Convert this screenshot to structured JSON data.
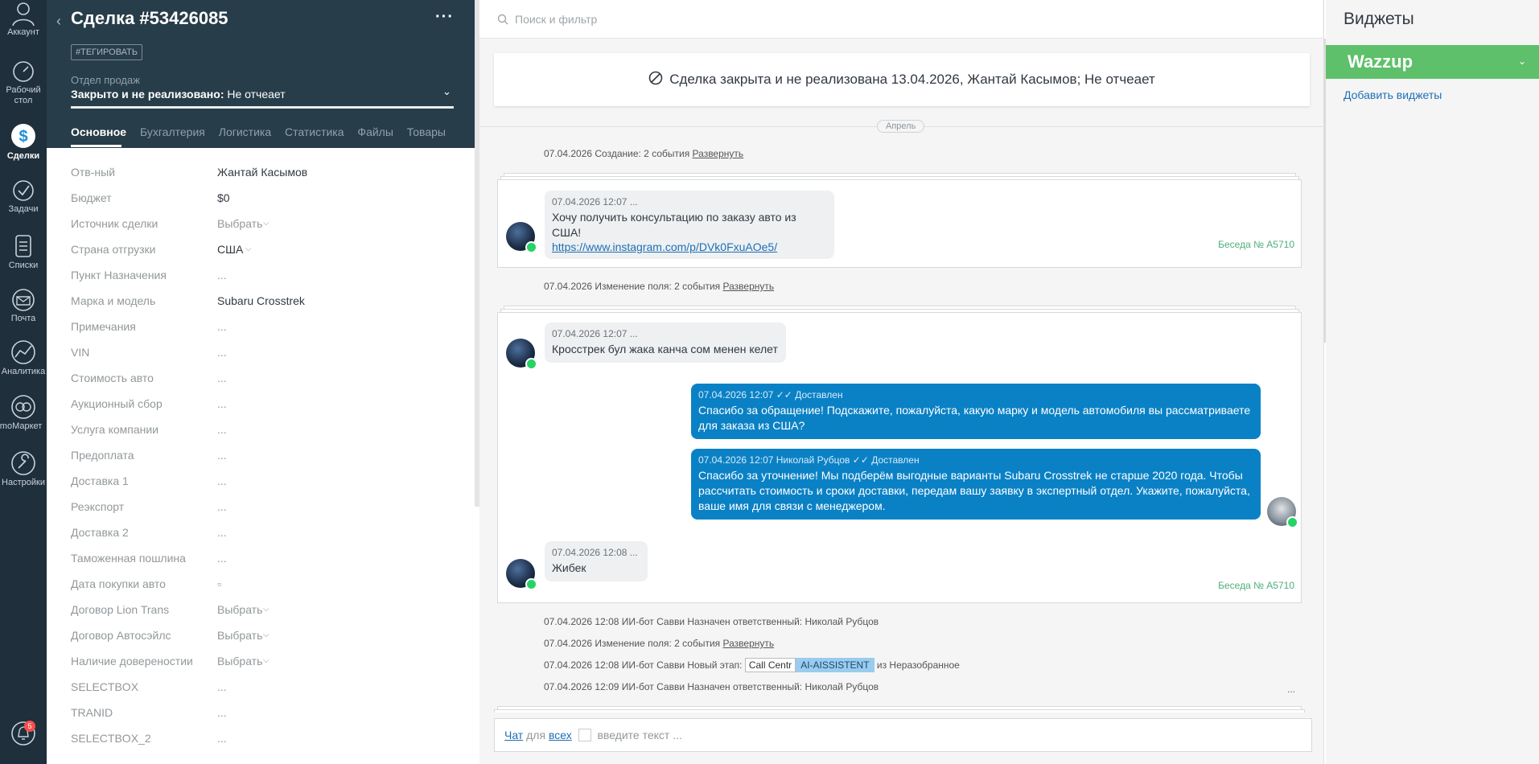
{
  "nav": {
    "items": [
      {
        "label": "Аккаунт",
        "icon": "user-icon"
      },
      {
        "label": "Рабочий стол",
        "icon": "dashboard-icon"
      },
      {
        "label": "Сделки",
        "icon": "deals-icon",
        "active": true
      },
      {
        "label": "Задачи",
        "icon": "tasks-check-icon"
      },
      {
        "label": "Списки",
        "icon": "lists-icon"
      },
      {
        "label": "Почта",
        "icon": "mail-icon"
      },
      {
        "label": "Аналитика",
        "icon": "analytics-icon"
      },
      {
        "label": "amoМаркет",
        "icon": "market-icon"
      },
      {
        "label": "Настройки",
        "icon": "settings-icon"
      }
    ],
    "notifications_badge": "5"
  },
  "card": {
    "title": "Сделка #53426085",
    "menu": "···",
    "tag_button": "#ТЕГИРОВАТЬ",
    "pipeline": "Отдел продаж",
    "status_bold": "Закрыто и не реализовано:",
    "status_reason": "Не отчеает",
    "tabs": [
      "Основное",
      "Бухгалтерия",
      "Логистика",
      "Статистика",
      "Файлы",
      "Товары",
      "···"
    ],
    "fields": [
      {
        "label": "Отв-ный",
        "value": "Жантай Касымов"
      },
      {
        "label": "Бюджет",
        "value": "$0"
      },
      {
        "label": "Источник сделки",
        "value": "Выбрать"
      },
      {
        "label": "Страна отгрузки",
        "value": "США"
      },
      {
        "label": "Пункт Назначения",
        "value": "..."
      },
      {
        "label": "Марка и модель",
        "value": "Subaru Crosstrek"
      },
      {
        "label": "Примечания",
        "value": "..."
      },
      {
        "label": "VIN",
        "value": "..."
      },
      {
        "label": "Стоимость авто",
        "value": "..."
      },
      {
        "label": "Аукционный сбор",
        "value": "..."
      },
      {
        "label": "Услуга компании",
        "value": "..."
      },
      {
        "label": "Предоплата",
        "value": "..."
      },
      {
        "label": "Доставка 1",
        "value": "..."
      },
      {
        "label": "Реэкспорт",
        "value": "..."
      },
      {
        "label": "Доставка 2",
        "value": "..."
      },
      {
        "label": "Таможенная пошлина",
        "value": "..."
      },
      {
        "label": "Дата покупки авто",
        "value": "▫"
      },
      {
        "label": "Договор Lion Trans",
        "value": "Выбрать"
      },
      {
        "label": "Договор Автосэйлс",
        "value": "Выбрать"
      },
      {
        "label": "Наличие довереностии",
        "value": "Выбрать"
      },
      {
        "label": "SELECTBOX",
        "value": "..."
      },
      {
        "label": "TRANID",
        "value": "..."
      },
      {
        "label": "SELECTBOX_2",
        "value": "..."
      }
    ]
  },
  "feed": {
    "search_placeholder": "Поиск и фильтр",
    "closed_banner": "Сделка закрыта и не реализована 13.04.2026, Жантай Касымов; Не отчеает",
    "month": "Апрель",
    "events": {
      "created": "07.04.2026 Создание: 2 события",
      "field_change_1": "07.04.2026 Изменение поля: 2 события",
      "assigned_1": "07.04.2026 12:08 ИИ-бот Савви Назначен ответственный: Николай Рубцов",
      "field_change_2": "07.04.2026 Изменение поля: 2 события",
      "stage_prefix": "07.04.2026 12:08 ИИ-бот Савви Новый этап:",
      "stage_from_pipeline": "Call Centr",
      "stage_to": "AI-AISSISTENT",
      "stage_suffix": "из Неразобранное",
      "assigned_2": "07.04.2026 12:09 ИИ-бот Савви Назначен ответственный: Николай Рубцов",
      "expand": "Развернуть"
    },
    "chat1": {
      "meta": "07.04.2026 12:07 ...",
      "text": "Хочу получить консультацию по заказу авто из США!",
      "link": "https://www.instagram.com/p/DVk0FxuAOe5/",
      "conversation": "Беседа № A5710"
    },
    "chat2": {
      "in1_meta": "07.04.2026 12:07 ...",
      "in1_text": "Кросстрек бул жака канча сом менен келет",
      "out1_meta": "07.04.2026 12:07  ✓✓ Доставлен",
      "out1_text": "Спасибо за обращение! Подскажите, пожалуйста, какую марку и модель автомобиля вы рассматриваете для заказа из США?",
      "out2_meta": "07.04.2026 12:07 Николай Рубцов  ✓✓ Доставлен",
      "out2_text": "Спасибо за уточнение! Мы подберём выгодные варианты Subaru Crosstrek не старше 2020 года. Чтобы рассчитать стоимость и сроки доставки, передам вашу заявку в экспертный отдел. Укажите, пожалуйста, ваше имя для связи с менеджером.",
      "in2_meta": "07.04.2026 12:08 ...",
      "in2_text": "Жибек",
      "conversation": "Беседа № A5710"
    },
    "composer": {
      "chat_link": "Чат",
      "for_text": "для",
      "all_link": "всех",
      "placeholder": "введите текст ..."
    },
    "more": "..."
  },
  "widgets": {
    "title": "Виджеты",
    "wazzup": "Wazzup",
    "add": "Добавить виджеты"
  },
  "colors": {
    "nav_bg": "#1f2f3b",
    "card_head_bg": "#273d49",
    "outgoing_bubble": "#0a81c5",
    "wazzup_green": "#5ec06a",
    "link": "#1f6fb5"
  }
}
